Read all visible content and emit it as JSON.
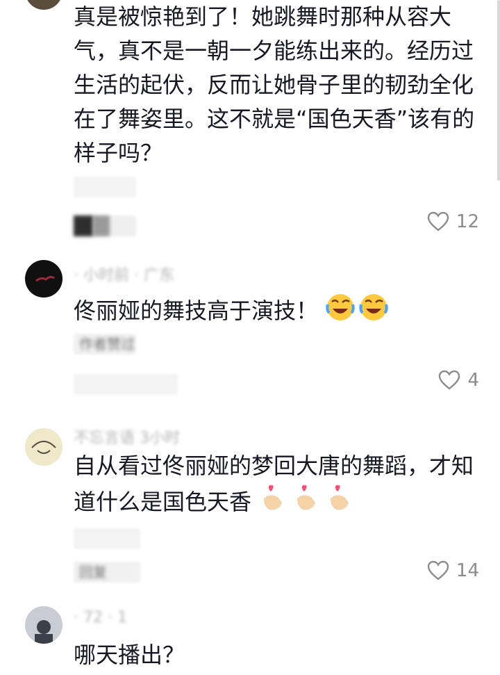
{
  "comments": [
    {
      "text": "真是被惊艳到了！她跳舞时那种从容大气，真不是一朝一夕能练出来的。经历过生活的起伏，反而让她骨子里的韧劲全化在了舞姿里。这不就是“国色天香”该有的样子吗？",
      "likes": "12"
    },
    {
      "meta": "· 小时前 · 广东",
      "text": "佟丽娅的舞技高于演技！",
      "chip": "作者赞过",
      "likes": "4"
    },
    {
      "meta": "不忘言语  3小时",
      "text": "自从看过佟丽娅的梦回大唐的舞蹈，才知道什么是国色天香",
      "chip": "回复",
      "likes": "14"
    },
    {
      "meta": "· 72 · 1",
      "text": "哪天播出？"
    }
  ],
  "icons": {
    "like": "heart-outline-icon",
    "laugh": "laughing-crying-emoji",
    "finger_heart": "finger-heart-emoji"
  },
  "colors": {
    "text": "#161823",
    "muted": "#8c8c8c"
  }
}
